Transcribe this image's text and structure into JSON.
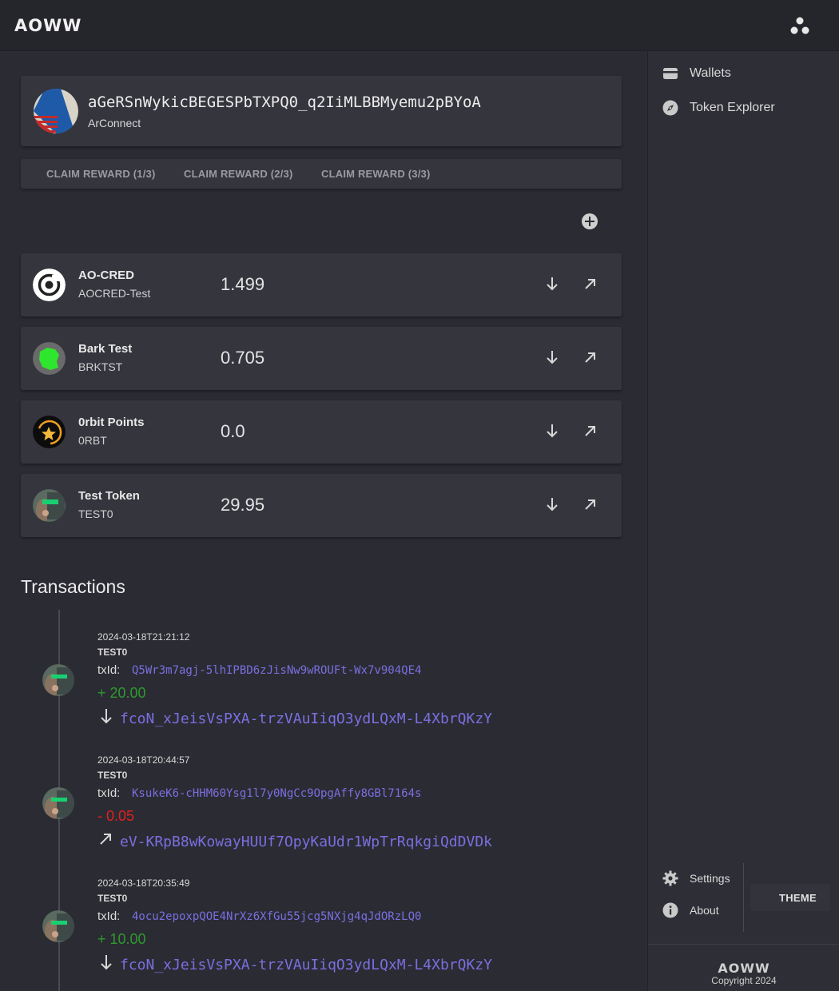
{
  "app": {
    "logo": "AOWW"
  },
  "wallet": {
    "address": "aGeRSnWykicBEGESPbTXPQ0_q2IiMLBBMyemu2pBYoA",
    "provider": "ArConnect"
  },
  "claim_buttons": [
    "CLAIM REWARD (1/3)",
    "CLAIM REWARD (2/3)",
    "CLAIM REWARD (3/3)"
  ],
  "tokens": [
    {
      "name": "AO-CRED",
      "ticker": "AOCRED-Test",
      "balance": "1.499",
      "icon": "ao-cred-icon"
    },
    {
      "name": "Bark Test",
      "ticker": "BRKTST",
      "balance": "0.705",
      "icon": "bark-test-icon"
    },
    {
      "name": "0rbit Points",
      "ticker": "0RBT",
      "balance": "0.0",
      "icon": "orbit-points-icon"
    },
    {
      "name": "Test Token",
      "ticker": "TEST0",
      "balance": "29.95",
      "icon": "test-token-icon"
    }
  ],
  "transactions": {
    "title": "Transactions",
    "txid_label": "txId:",
    "items": [
      {
        "date": "2024-03-18T21:21:12",
        "ticker": "TEST0",
        "txid": "Q5Wr3m7agj-5lhIPBD6zJisNw9wROUFt-Wx7v904QE4",
        "amount": "+ 20.00",
        "direction": "in",
        "counterparty": "fcoN_xJeisVsPXA-trzVAuIiqO3ydLQxM-L4XbrQKzY"
      },
      {
        "date": "2024-03-18T20:44:57",
        "ticker": "TEST0",
        "txid": "KsukeK6-cHHM60Ysg1l7y0NgCc9OpgAffy8GBl7164s",
        "amount": "- 0.05",
        "direction": "out",
        "counterparty": "eV-KRpB8wKowayHUUf7OpyKaUdr1WpTrRqkgiQdDVDk"
      },
      {
        "date": "2024-03-18T20:35:49",
        "ticker": "TEST0",
        "txid": "4ocu2epoxpQOE4NrXz6XfGu55jcg5NXjg4qJdORzLQ0",
        "amount": "+ 10.00",
        "direction": "in",
        "counterparty": "fcoN_xJeisVsPXA-trzVAuIiqO3ydLQxM-L4XbrQKzY"
      }
    ]
  },
  "sidebar": {
    "nav": [
      {
        "label": "Wallets",
        "icon": "wallet-icon"
      },
      {
        "label": "Token Explorer",
        "icon": "compass-icon"
      }
    ],
    "bottom": [
      {
        "label": "Settings",
        "icon": "gear-icon"
      },
      {
        "label": "About",
        "icon": "info-icon"
      }
    ],
    "theme_label": "THEME",
    "footer_logo": "AOWW",
    "copyright": "Copyright 2024"
  },
  "colors": {
    "background": "#2b2b33",
    "card": "#35353e",
    "link": "#7b6fe0",
    "positive": "#2e9a2e",
    "negative": "#e02020",
    "theme_accent": "#8b7cf0"
  }
}
